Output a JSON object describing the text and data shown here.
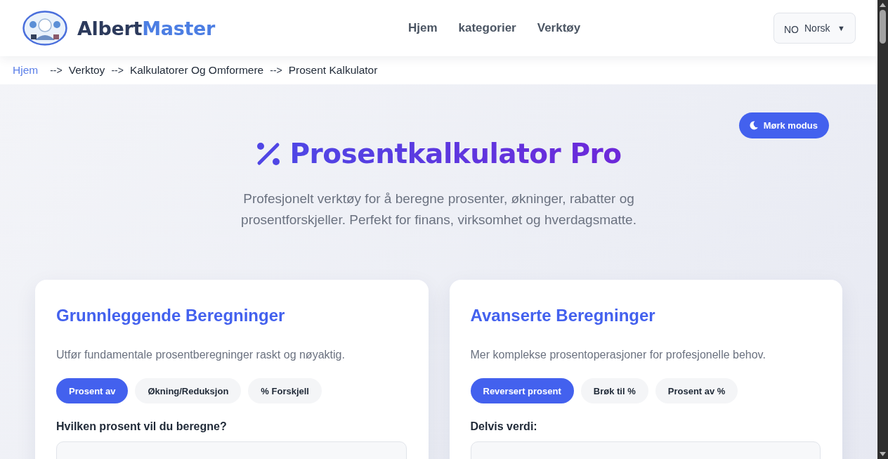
{
  "header": {
    "brand": {
      "part_1": "Albert",
      "part_2": "Master"
    },
    "nav": [
      {
        "label": "Hjem"
      },
      {
        "label": "kategorier"
      },
      {
        "label": "Verktøy"
      }
    ],
    "language": {
      "code": "NO",
      "label": "Norsk",
      "caret": "▼"
    }
  },
  "breadcrumb": [
    {
      "label": "Hjem",
      "kind": "link"
    },
    {
      "label": "-->",
      "kind": "separator"
    },
    {
      "label": "Verktoy",
      "kind": "item"
    },
    {
      "label": "-->",
      "kind": "separator"
    },
    {
      "label": "Kalkulatorer Og Omformere",
      "kind": "item"
    },
    {
      "label": "-->",
      "kind": "separator"
    },
    {
      "label": "Prosent Kalkulator",
      "kind": "item"
    }
  ],
  "hero": {
    "theme_button": "Mørk modus",
    "title": "Prosentkalkulator Pro",
    "subtitle": "Profesjonelt verktøy for å beregne prosenter, økninger, rabatter og prosentforskjeller. Perfekt for finans, virksomhet og hverdagsmatte."
  },
  "cards": [
    {
      "title": "Grunnleggende Beregninger",
      "description": "Utfør fundamentale prosentberegninger raskt og nøyaktig.",
      "tabs": [
        {
          "label": "Prosent av",
          "selected": true
        },
        {
          "label": "Økning/Reduksjon",
          "selected": false
        },
        {
          "label": "% Forskjell",
          "selected": false
        }
      ],
      "field": {
        "label": "Hvilken prosent vil du beregne?"
      }
    },
    {
      "title": "Avanserte Beregninger",
      "description": "Mer komplekse prosentoperasjoner for profesjonelle behov.",
      "tabs": [
        {
          "label": "Reversert prosent",
          "selected": true
        },
        {
          "label": "Brøk til %",
          "selected": false
        },
        {
          "label": "Prosent av %",
          "selected": false
        }
      ],
      "field": {
        "label": "Delvis verdi:"
      }
    }
  ]
}
